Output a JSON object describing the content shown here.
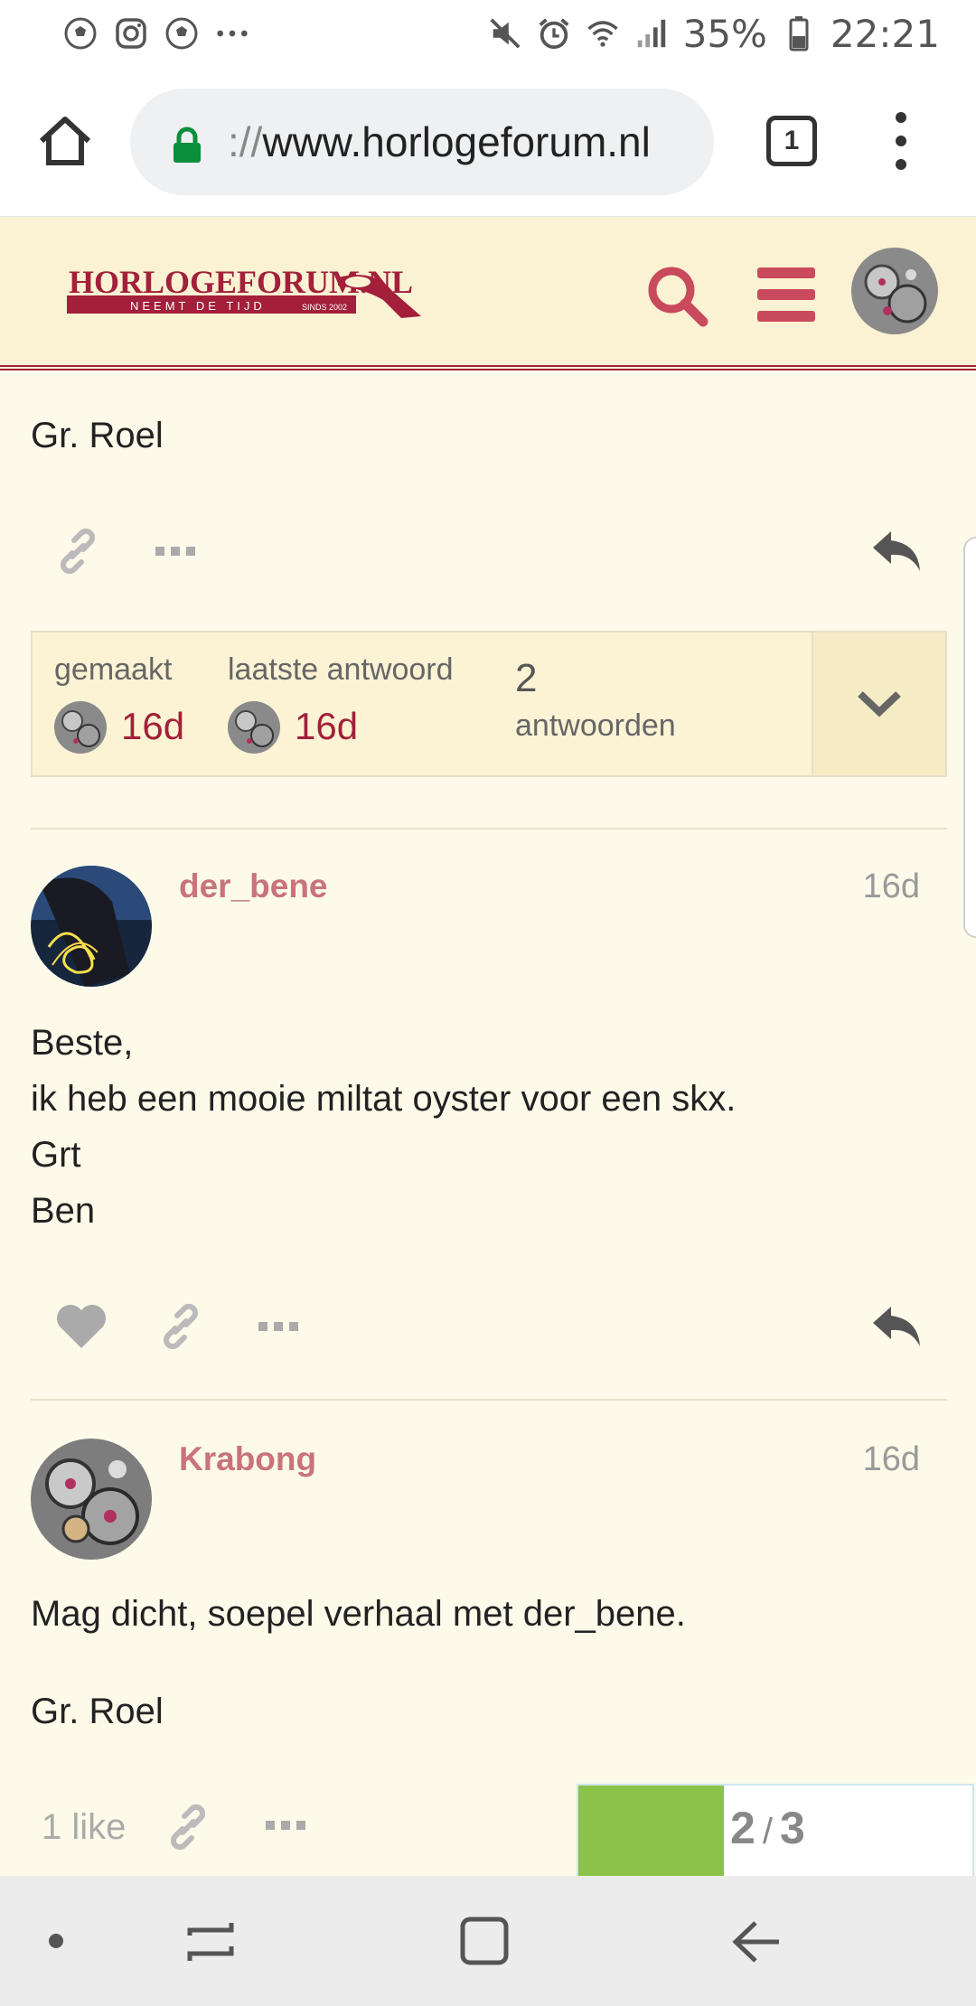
{
  "statusbar": {
    "notification_icons": [
      "soccer-ball-icon",
      "instagram-icon",
      "soccer-ball-icon",
      "more-dots-icon"
    ],
    "battery": "35%",
    "time": "22:21"
  },
  "browser": {
    "url_prefix": "://",
    "url_domain": "www.horlogeforum.nl",
    "tab_count": "1"
  },
  "forum": {
    "logo_title": "HORLOGEFORUM.NL",
    "logo_tagline": "NEEMT DE TIJD",
    "logo_since": "SINDS 2002",
    "accent": "#a31f3a"
  },
  "first_post": {
    "closing": "Gr. Roel"
  },
  "topic_map": {
    "created_label": "gemaakt",
    "created_value": "16d",
    "last_reply_label": "laatste antwoord",
    "last_reply_value": "16d",
    "replies_count": "2",
    "replies_label": "antwoorden"
  },
  "posts": [
    {
      "username": "der_bene",
      "date": "16d",
      "lines": [
        "Beste,",
        "ik heb een mooie miltat oyster voor een skx.",
        "Grt",
        "Ben"
      ]
    },
    {
      "username": "Krabong",
      "date": "16d",
      "lines": [
        "Mag dicht, soepel verhaal met der_bene.",
        "Gr. Roel"
      ],
      "likes": "1 like"
    }
  ],
  "progress": {
    "current": "2",
    "separator": "/",
    "total": "3",
    "fraction": 0.37
  }
}
